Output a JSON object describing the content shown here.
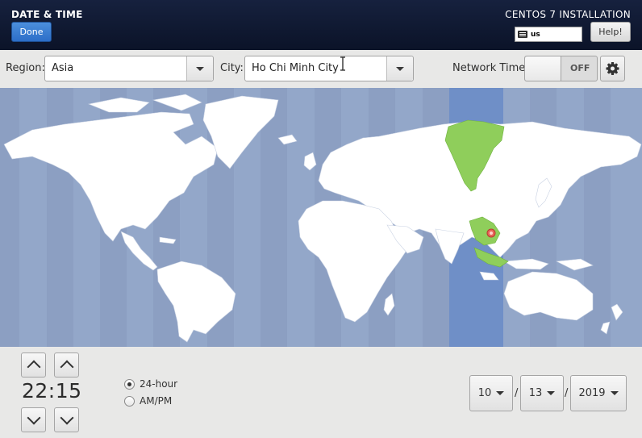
{
  "header": {
    "title": "DATE & TIME",
    "done_label": "Done",
    "install_title": "CENTOS 7 INSTALLATION",
    "keyboard_layout": "us",
    "help_label": "Help!"
  },
  "toolbar": {
    "region_label": "Region:",
    "region_value": "Asia",
    "city_label": "City:",
    "city_value": "Ho Chi Minh City",
    "network_time_label": "Network Time",
    "network_time_state": "OFF"
  },
  "map": {
    "ocean_color": "#93a7c9",
    "land_color": "#ffffff",
    "selected_zone_color": "#8fce5b",
    "selected_timezone_band_color": "#6f8fc7",
    "marker_color": "#e8655a"
  },
  "time": {
    "value": "22:15",
    "format_24": "24-hour",
    "format_ampm": "AM/PM",
    "selected_format": "24-hour"
  },
  "date": {
    "month": "10",
    "day": "13",
    "year": "2019",
    "separator": "/"
  }
}
